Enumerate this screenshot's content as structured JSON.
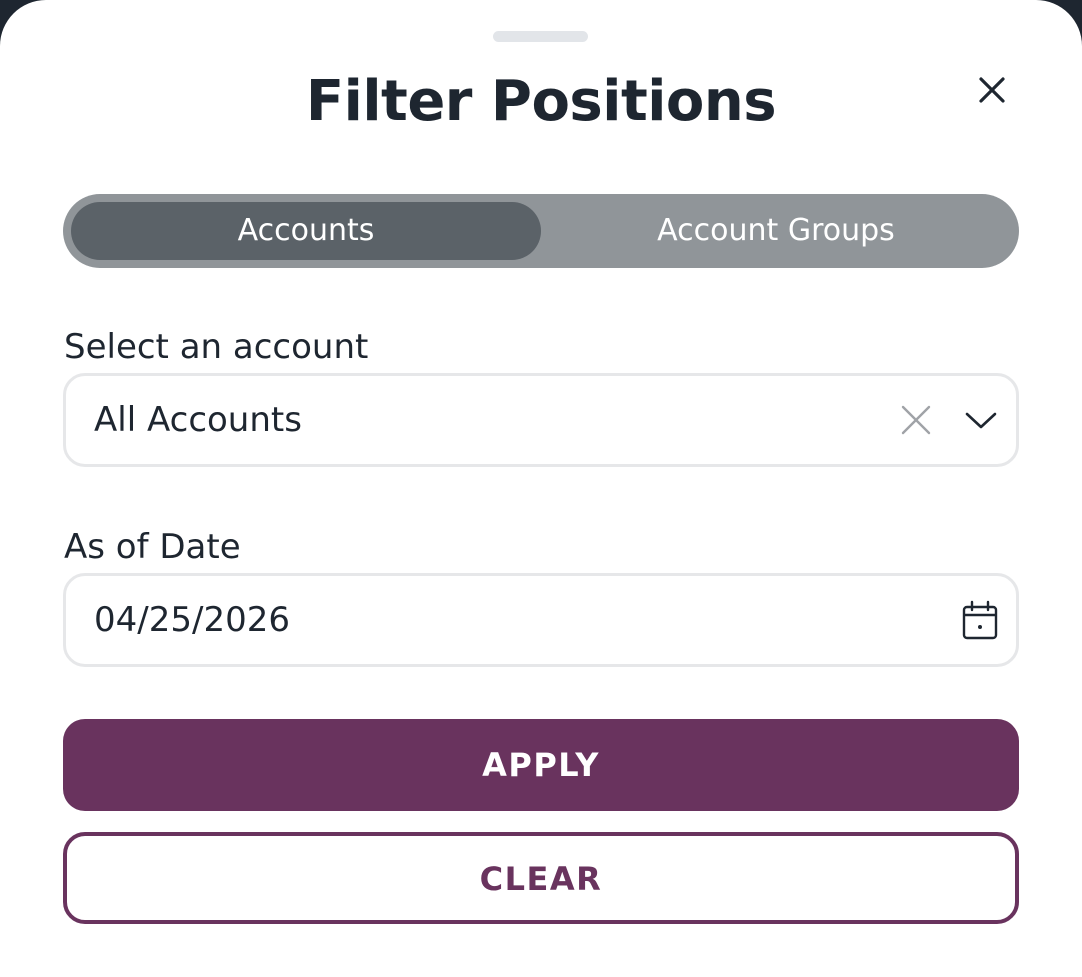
{
  "sheet": {
    "title": "Filter Positions",
    "close_icon": "close-icon"
  },
  "tabs": [
    {
      "label": "Accounts",
      "selected": true
    },
    {
      "label": "Account Groups",
      "selected": false
    }
  ],
  "account_field": {
    "label": "Select an account",
    "value": "All Accounts",
    "icons": [
      "clear-x-icon",
      "chevron-down-icon"
    ]
  },
  "date_field": {
    "label": "As of Date",
    "value": "04/25/2026",
    "icon": "calendar-icon"
  },
  "actions": {
    "apply_label": "APPLY",
    "clear_label": "CLEAR"
  },
  "colors": {
    "title_text": "#1e2630",
    "segment_track": "#909599",
    "segment_active": "#5b6268",
    "primary": "#69335e",
    "field_border": "#e6e7e9",
    "handle": "#e2e5e9"
  }
}
